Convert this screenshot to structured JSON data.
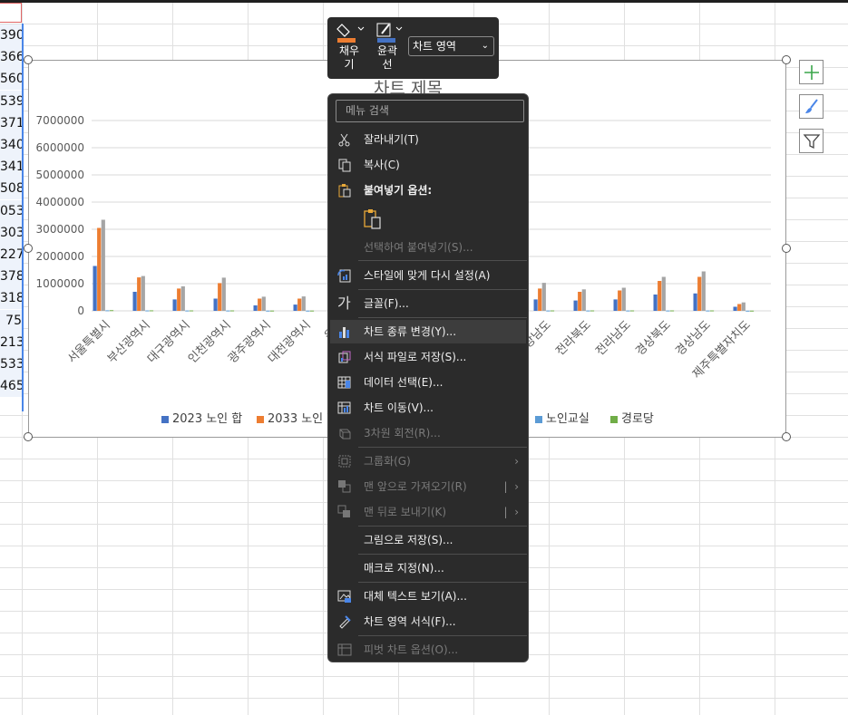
{
  "sheet": {
    "column_values": [
      "390",
      "366",
      "560",
      "539",
      "371",
      "340",
      "341",
      "508",
      "053",
      "303",
      "227",
      "378",
      "318",
      "75",
      "213",
      "533",
      "465"
    ]
  },
  "chart": {
    "title": "차트 제목",
    "legend": [
      "2023 노인 합",
      "2033 노인 합",
      "노인교실",
      "경로당"
    ]
  },
  "chart_data": {
    "type": "bar",
    "title": "차트 제목",
    "xlabel": "",
    "ylabel": "",
    "ylim": [
      0,
      7000000
    ],
    "y_ticks": [
      "7000000",
      "6000000",
      "5000000",
      "4000000",
      "3000000",
      "2000000",
      "1000000",
      "0"
    ],
    "categories_visible": [
      "서울특별시",
      "부산광역시",
      "대구광역시",
      "인천광역시",
      "광주광역시",
      "대전광역시",
      "울산",
      "경상남도",
      "전라북도",
      "전라남도",
      "경상북도",
      "경상남도",
      "제주특별자치도"
    ],
    "series": [
      {
        "name": "2023 노인 합",
        "color": "#4472c4",
        "values": [
          1650000,
          700000,
          420000,
          450000,
          200000,
          230000,
          null,
          420000,
          380000,
          420000,
          600000,
          640000,
          150000
        ]
      },
      {
        "name": "2033 노인 합",
        "color": "#ed7d31",
        "values": [
          3050000,
          1230000,
          820000,
          1020000,
          450000,
          450000,
          null,
          820000,
          700000,
          750000,
          1100000,
          1250000,
          250000
        ]
      },
      {
        "name": "",
        "color": "#a5a5a5",
        "values": [
          3350000,
          1280000,
          900000,
          1220000,
          520000,
          530000,
          null,
          1030000,
          790000,
          850000,
          1250000,
          1450000,
          310000
        ]
      },
      {
        "name": "노인교실",
        "color": "#5b9bd5",
        "values": [
          20000,
          15000,
          12000,
          12000,
          8000,
          8000,
          null,
          12000,
          12000,
          12000,
          12000,
          12000,
          6000
        ]
      },
      {
        "name": "경로당",
        "color": "#70ad47",
        "values": [
          25000,
          18000,
          15000,
          15000,
          10000,
          10000,
          null,
          15000,
          15000,
          15000,
          15000,
          15000,
          8000
        ]
      }
    ],
    "legend_placement": "bottom",
    "grid": true
  },
  "mini_toolbar": {
    "fill_label": "채우\n기",
    "fill_line1": "채우",
    "fill_line2": "기",
    "outline_line1": "윤곽",
    "outline_line2": "선",
    "area_select": "차트 영역"
  },
  "context_menu": {
    "search_placeholder": "메뉴 검색",
    "items": {
      "cut": "잘라내기(T)",
      "copy": "복사(C)",
      "paste_options": "붙여넣기 옵션:",
      "paste_special": "선택하여 붙여넣기(S)...",
      "reset_style": "스타일에 맞게 다시 설정(A)",
      "font": "글꼴(F)...",
      "change_chart_type": "차트 종류 변경(Y)...",
      "save_template": "서식 파일로 저장(S)...",
      "select_data": "데이터 선택(E)...",
      "move_chart": "차트 이동(V)...",
      "rotate_3d": "3차원 회전(R)...",
      "group": "그룹화(G)",
      "bring_front": "맨 앞으로 가져오기(R)",
      "send_back": "맨 뒤로 보내기(K)",
      "save_picture": "그림으로 저장(S)...",
      "assign_macro": "매크로 지정(N)...",
      "alt_text": "대체 텍스트 보기(A)...",
      "format_chart_area": "차트 영역 서식(F)...",
      "pivot_options": "피벗 차트 옵션(O)..."
    }
  },
  "colors": {
    "menu_bg": "#2b2b2b",
    "accent_blue": "#4a86e8"
  }
}
